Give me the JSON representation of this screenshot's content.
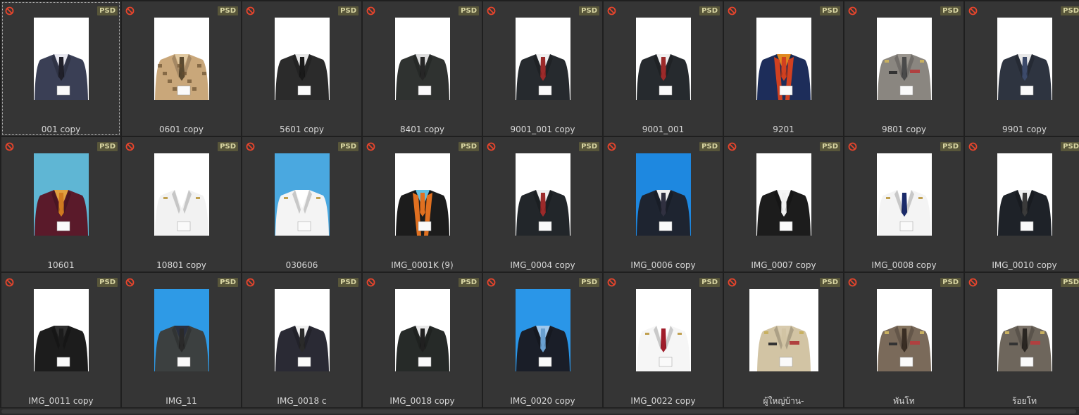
{
  "format_badge": "PSD",
  "rows": [
    [
      {
        "name": "001 copy",
        "bg": "#ffffff",
        "suit": "#3a3f55",
        "tie": "#20202a",
        "shirt": "#e8e8f0",
        "selected": true
      },
      {
        "name": "0601 copy",
        "bg": "#ffffff",
        "suit": "#c9a77a",
        "tie": "#5b4a30",
        "shirt": "#e0c8a0",
        "pattern": true
      },
      {
        "name": "5601 copy",
        "bg": "#ffffff",
        "suit": "#2b2b2b",
        "tie": "#1a1a1a",
        "shirt": "#e6e6e6"
      },
      {
        "name": "8401 copy",
        "bg": "#ffffff",
        "suit": "#2f3230",
        "tie": "#262626",
        "shirt": "#dcdcdc"
      },
      {
        "name": "9001_001 copy",
        "bg": "#ffffff",
        "suit": "#262a2e",
        "tie": "#9c2a2a",
        "shirt": "#f0f0f0"
      },
      {
        "name": "9001_001",
        "bg": "#ffffff",
        "suit": "#262a2e",
        "tie": "#9c2a2a",
        "shirt": "#f0f0f0"
      },
      {
        "name": "9201",
        "bg": "#ffffff",
        "suit": "#1d2d5a",
        "tie": "#d04020",
        "shirt": "#e08a20",
        "gown": true
      },
      {
        "name": "9801 copy",
        "bg": "#ffffff",
        "suit": "#8a8680",
        "tie": "#4a4a4a",
        "shirt": "#9a958e",
        "uniform": true
      },
      {
        "name": "9901 copy",
        "bg": "#ffffff",
        "suit": "#2e3440",
        "tie": "#3c4a6a",
        "shirt": "#e8e8e8"
      }
    ],
    [
      {
        "name": "10601",
        "bg": "#5fb6d4",
        "suit": "#5a1a2a",
        "tie": "#d07a20",
        "shirt": "#e0a040"
      },
      {
        "name": "10801 copy",
        "bg": "#ffffff",
        "suit": "#f2f2f2",
        "tie": "#f2f2f2",
        "shirt": "#ffffff",
        "white": true
      },
      {
        "name": "030606",
        "bg": "#4aa8e0",
        "suit": "#f4f4f4",
        "tie": "#f4f4f4",
        "shirt": "#ffffff",
        "white": true
      },
      {
        "name": "IMG_0001K (9)",
        "bg": "#ffffff",
        "suit": "#1c1c1c",
        "tie": "#e07020",
        "shirt": "#60c0e0",
        "gown": true
      },
      {
        "name": "IMG_0004 copy",
        "bg": "#ffffff",
        "suit": "#22262a",
        "tie": "#9c2a2a",
        "shirt": "#f0f0f0"
      },
      {
        "name": "IMG_0006 copy",
        "bg": "#1e88e0",
        "suit": "#1e2430",
        "tie": "#303040",
        "shirt": "#f0f0f0"
      },
      {
        "name": "IMG_0007 copy",
        "bg": "#ffffff",
        "suit": "#1c1c1c",
        "tie": "#f0f0f0",
        "shirt": "#f4f4f4"
      },
      {
        "name": "IMG_0008 copy",
        "bg": "#ffffff",
        "suit": "#f4f4f4",
        "tie": "#1a2a6a",
        "shirt": "#ffffff",
        "white": true
      },
      {
        "name": "IMG_0010 copy",
        "bg": "#ffffff",
        "suit": "#1e2228",
        "tie": "#3a3a3a",
        "shirt": "#f0f0f0"
      }
    ],
    [
      {
        "name": "IMG_0011 copy",
        "bg": "#ffffff",
        "suit": "#1c1c1c",
        "tie": "#1c1c1c",
        "shirt": "#303030"
      },
      {
        "name": "IMG_11",
        "bg": "#2e9ae6",
        "suit": "#3c4040",
        "tie": "#2a2a2a",
        "shirt": "#2a3040"
      },
      {
        "name": "IMG_0018 c",
        "bg": "#ffffff",
        "suit": "#2a2a34",
        "tie": "#2a2a2a",
        "shirt": "#f0f0f0"
      },
      {
        "name": "IMG_0018 copy",
        "bg": "#ffffff",
        "suit": "#262a28",
        "tie": "#202020",
        "shirt": "#e8e8e8"
      },
      {
        "name": "IMG_0020 copy",
        "bg": "#2a96e8",
        "suit": "#1a1e28",
        "tie": "#6aa0d0",
        "shirt": "#a0c8ec"
      },
      {
        "name": "IMG_0022 copy",
        "bg": "#ffffff",
        "suit": "#f6f6f6",
        "tie": "#a01c2a",
        "shirt": "#ffffff",
        "white": true
      },
      {
        "name": "ผู้ใหญ่บ้าน-",
        "bg": "#ffffff",
        "suit": "#d2c4a4",
        "tie": "#d2c4a4",
        "shirt": "#d8cbae",
        "uniform": true,
        "wide": true
      },
      {
        "name": "พันโท",
        "bg": "#ffffff",
        "suit": "#7a6a5a",
        "tie": "#3a2e24",
        "shirt": "#85745f",
        "uniform": true
      },
      {
        "name": "ร้อยโท",
        "bg": "#ffffff",
        "suit": "#6e665c",
        "tie": "#2a2622",
        "shirt": "#7b7268",
        "uniform": true
      }
    ]
  ]
}
